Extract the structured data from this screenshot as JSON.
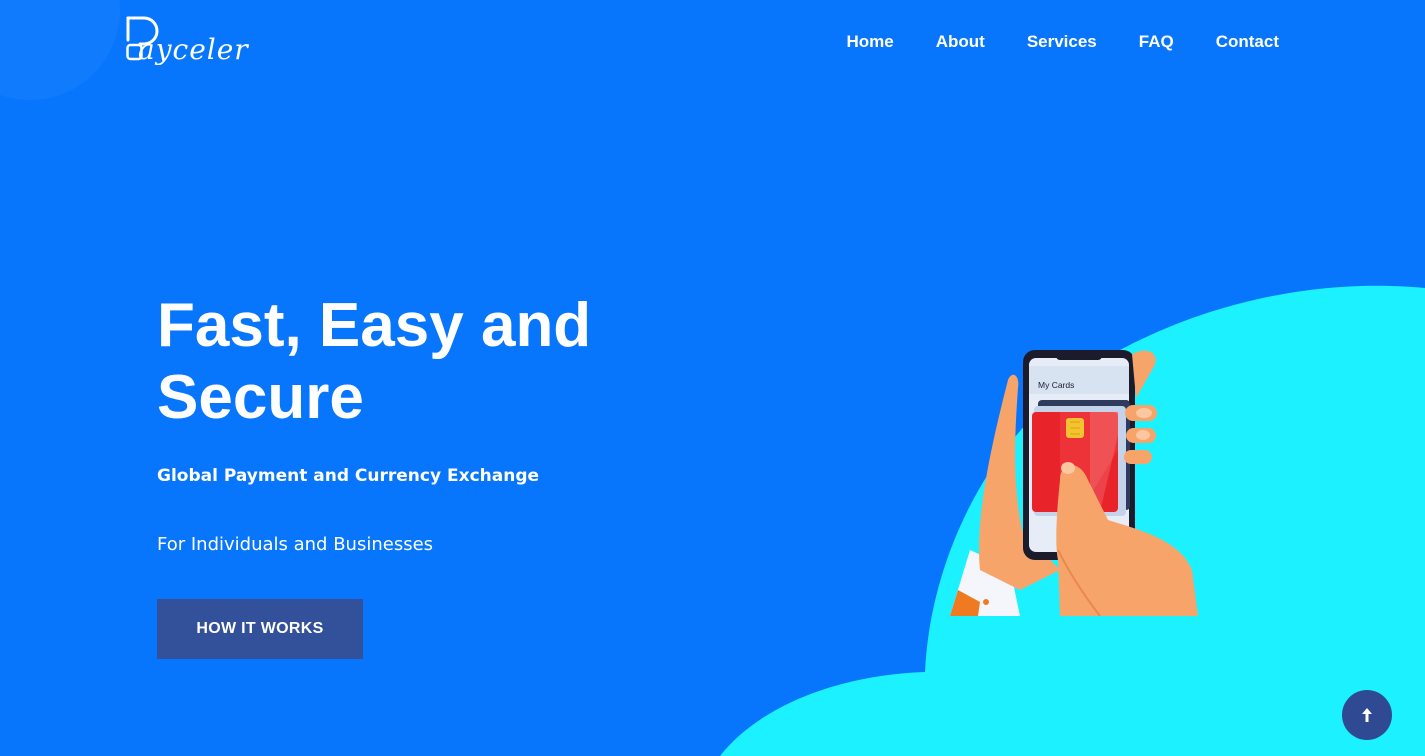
{
  "brand": {
    "name": "ayceler",
    "logo_letter": "P"
  },
  "nav": {
    "items": [
      {
        "label": "Home"
      },
      {
        "label": "About"
      },
      {
        "label": "Services"
      },
      {
        "label": "FAQ"
      },
      {
        "label": "Contact"
      }
    ]
  },
  "hero": {
    "title": "Fast, Easy and Secure",
    "subtitle": "Global Payment and Currency Exchange",
    "tagline": "For Individuals and Businesses",
    "cta_label": "HOW IT WORKS"
  },
  "illustration": {
    "phone_header": "My Cards"
  },
  "colors": {
    "background": "#0776fd",
    "cloud": "#1cf1ff",
    "button": "#33509b",
    "scroll_button": "#2f4a92",
    "card_red": "#e8232a"
  },
  "icons": {
    "scroll_top": "arrow-up-icon",
    "logo": "logo-mark-icon"
  }
}
